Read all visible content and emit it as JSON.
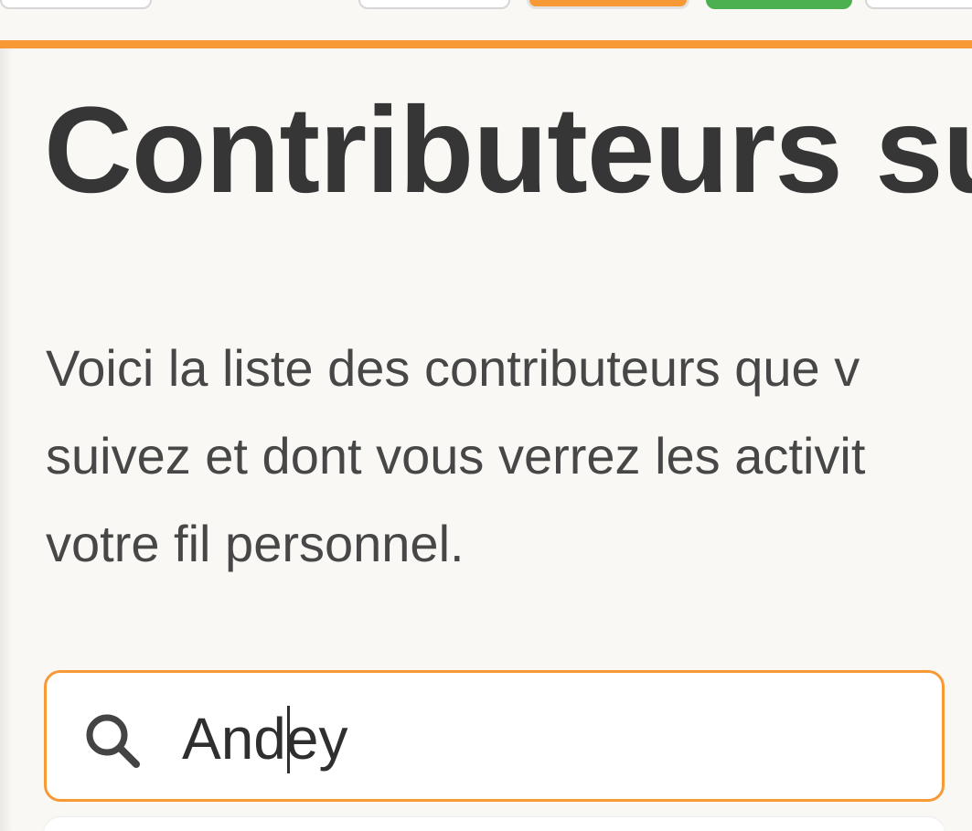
{
  "page": {
    "title": "Contributeurs su",
    "intro_lines": [
      "Voici la liste des contributeurs que v",
      "suivez et dont vous verrez les activit",
      "votre fil personnel."
    ]
  },
  "search": {
    "value": "Andey",
    "icon": "search-icon"
  },
  "colors": {
    "accent": "#f79a36",
    "success": "#4caf50",
    "background": "#f9f8f5",
    "text": "#363636"
  }
}
